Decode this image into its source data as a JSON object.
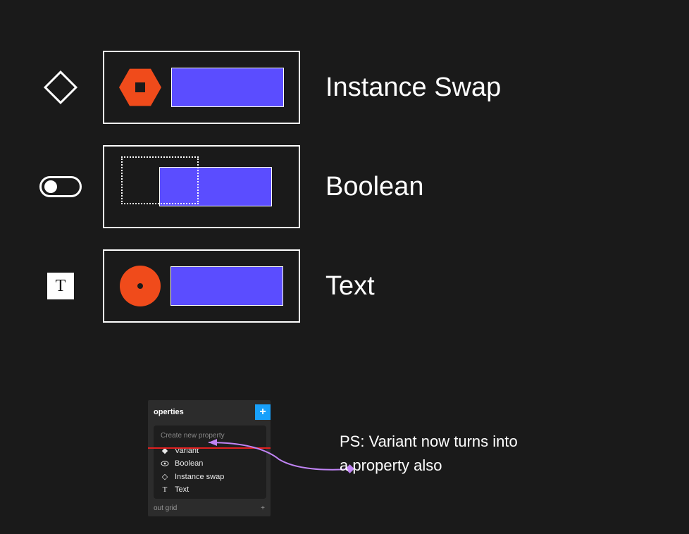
{
  "rows": {
    "instance_swap": {
      "label": "Instance Swap"
    },
    "boolean": {
      "label": "Boolean"
    },
    "text": {
      "label": "Text",
      "icon_glyph": "T"
    }
  },
  "panel": {
    "header": "operties",
    "plus": "+",
    "menu_header": "Create new property",
    "items": {
      "variant": "Variant",
      "boolean": "Boolean",
      "instance_swap": "Instance swap",
      "text": "Text"
    },
    "footer": "out grid"
  },
  "annotation": {
    "line1": "PS: Variant now turns into",
    "line2": "a property also"
  }
}
